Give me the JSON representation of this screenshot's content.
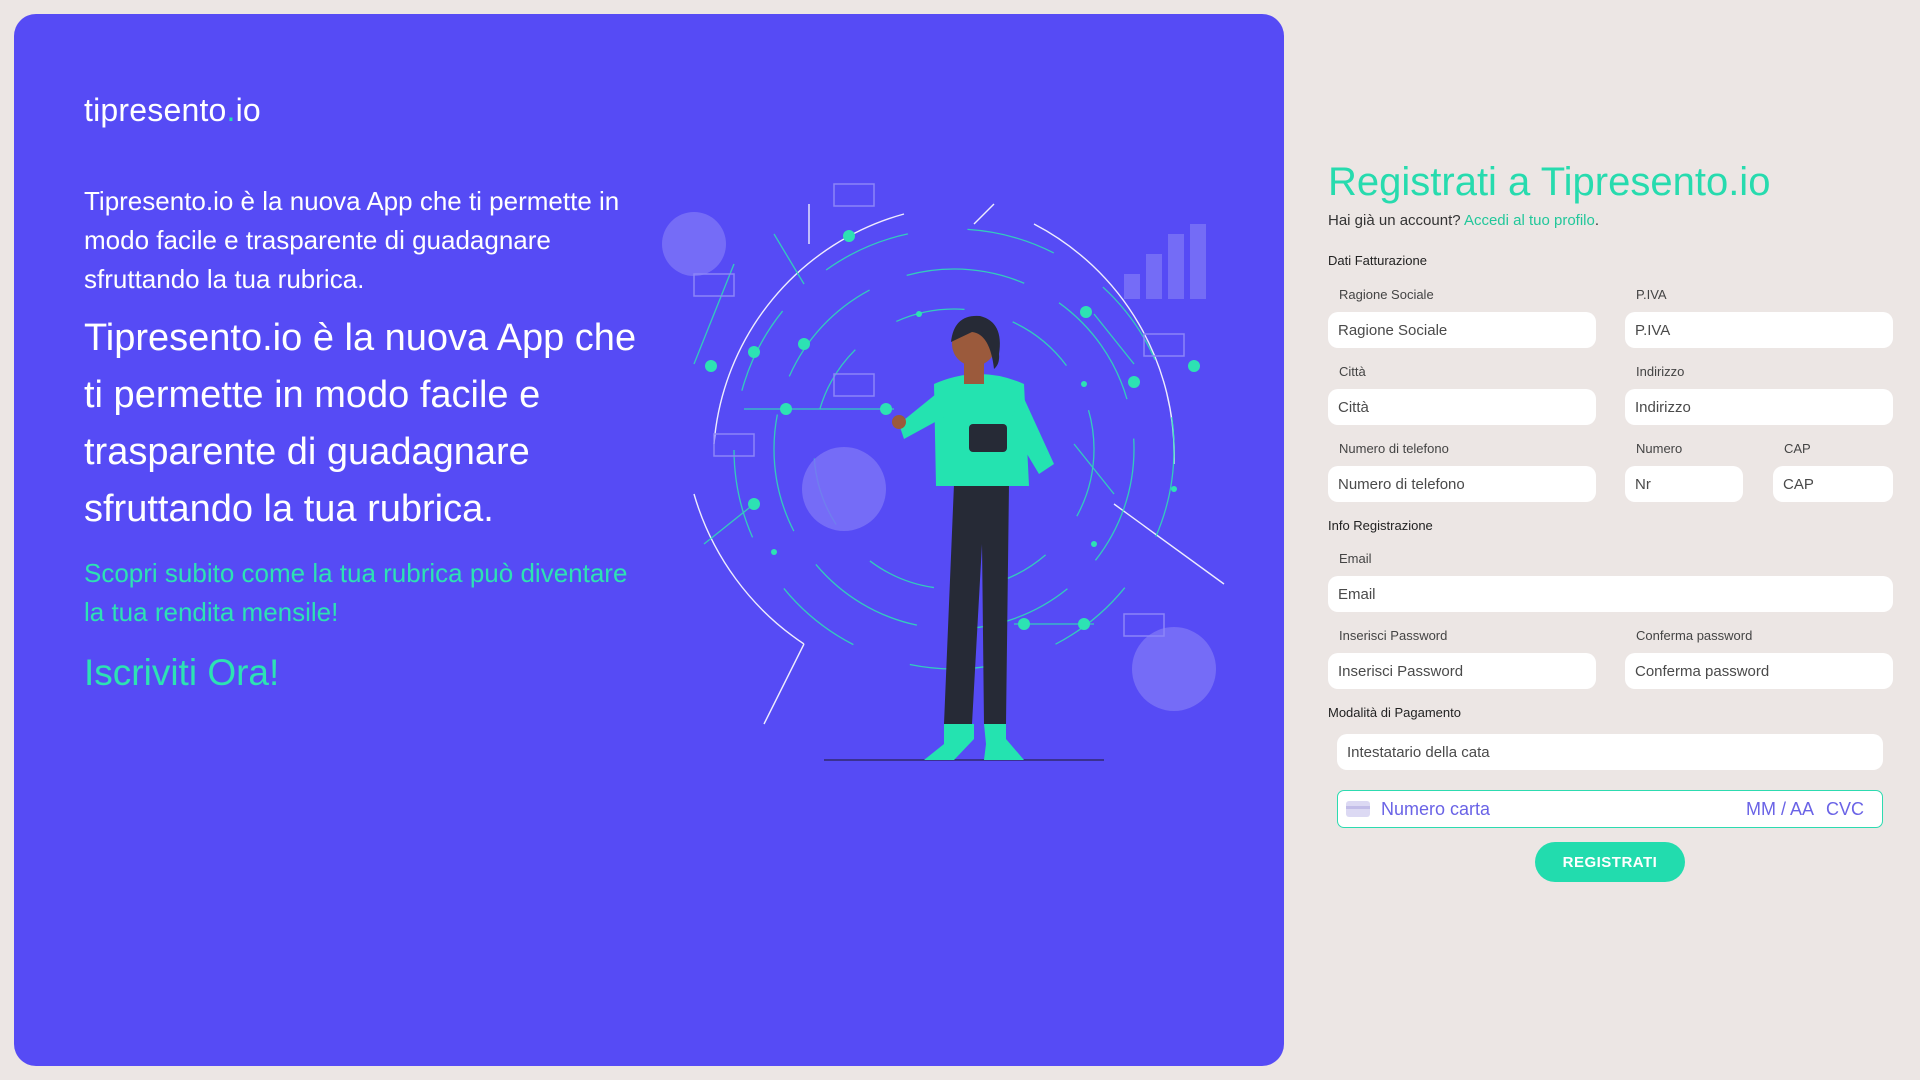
{
  "brand": {
    "name": "tipresento",
    "dot": ".",
    "tld": "io"
  },
  "hero": {
    "intro_small": "Tipresento.io è la nuova App che ti permette in modo facile e trasparente di guadagnare sfruttando la tua rubrica.",
    "intro_large": "Tipresento.io è la nuova App che ti permette in modo facile e trasparente di guadagnare sfruttando la tua rubrica.",
    "subtitle": "Scopri subito come la tua rubrica può diventare la tua rendita mensile!",
    "cta": "Iscriviti Ora!"
  },
  "form": {
    "title": "Registrati a Tipresento.io",
    "have_account": "Hai già un account?",
    "login_link": "Accedi al tuo profilo",
    "login_suffix": ".",
    "sections": {
      "billing": "Dati Fatturazione",
      "registration": "Info Registrazione",
      "payment": "Modalità di Pagamento"
    },
    "fields": {
      "company": {
        "label": "Ragione Sociale",
        "placeholder": "Ragione Sociale"
      },
      "vat": {
        "label": "P.IVA",
        "placeholder": "P.IVA"
      },
      "city": {
        "label": "Città",
        "placeholder": "Città"
      },
      "address": {
        "label": "Indirizzo",
        "placeholder": "Indirizzo"
      },
      "phone": {
        "label": "Numero di telefono",
        "placeholder": "Numero di telefono"
      },
      "number": {
        "label": "Numero",
        "placeholder": "Nr"
      },
      "zip": {
        "label": "CAP",
        "placeholder": "CAP"
      },
      "email": {
        "label": "Email",
        "placeholder": "Email"
      },
      "password": {
        "label": "Inserisci Password",
        "placeholder": "Inserisci Password"
      },
      "confirm": {
        "label": "Conferma password",
        "placeholder": "Conferma password"
      },
      "cardholder": {
        "placeholder": "Intestatario della cata"
      }
    },
    "card": {
      "number_placeholder": "Numero carta",
      "expiry_placeholder": "MM / AA",
      "cvc_placeholder": "CVC",
      "icon": "credit-card-icon"
    },
    "submit": "REGISTRATI"
  },
  "colors": {
    "hero_bg": "#564bf5",
    "accent": "#22dcae",
    "page_bg": "#ece6e4"
  }
}
